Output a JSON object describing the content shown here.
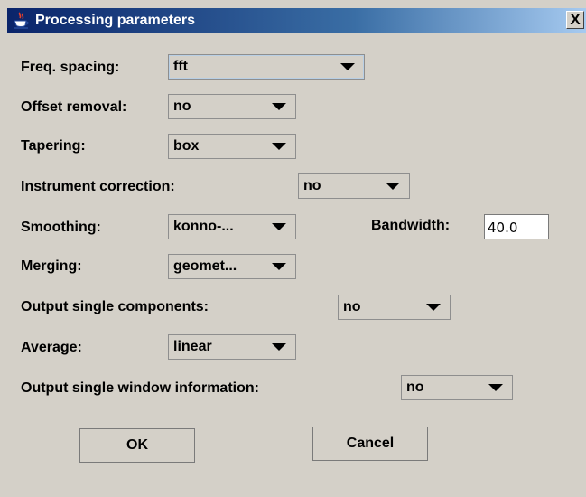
{
  "window": {
    "title": "Processing parameters",
    "close_glyph": "X"
  },
  "fields": {
    "freq_spacing": {
      "label": "Freq. spacing:",
      "value": "fft"
    },
    "offset_removal": {
      "label": "Offset removal:",
      "value": "no"
    },
    "tapering": {
      "label": "Tapering:",
      "value": "box"
    },
    "instrument_correction": {
      "label": "Instrument correction:",
      "value": "no"
    },
    "smoothing": {
      "label": "Smoothing:",
      "value": "konno-..."
    },
    "bandwidth": {
      "label": "Bandwidth:",
      "value": "40.0"
    },
    "merging": {
      "label": "Merging:",
      "value": "geomet..."
    },
    "output_single_components": {
      "label": "Output single components:",
      "value": "no"
    },
    "average": {
      "label": "Average:",
      "value": "linear"
    },
    "output_single_window_information": {
      "label": "Output single window information:",
      "value": "no"
    }
  },
  "buttons": {
    "ok": "OK",
    "cancel": "Cancel"
  },
  "icons": {
    "title": "java-coffee-cup-icon",
    "close": "close-icon",
    "dropdown": "chevron-down-icon"
  }
}
